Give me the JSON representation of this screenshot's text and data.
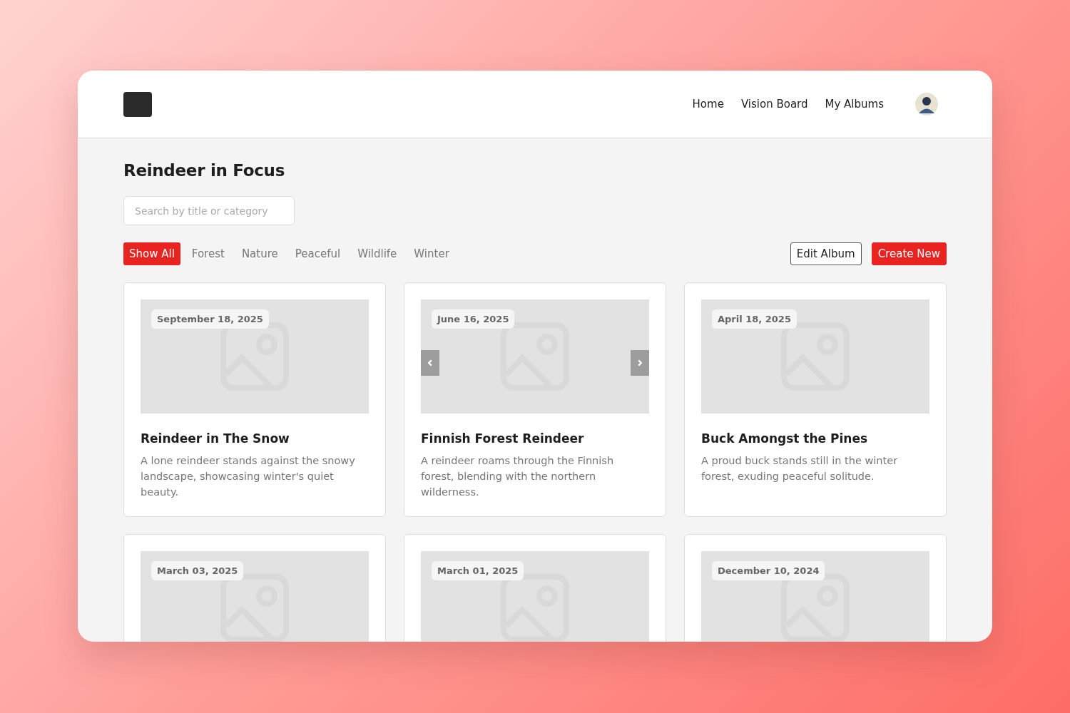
{
  "nav": {
    "links": [
      "Home",
      "Vision Board",
      "My Albums"
    ]
  },
  "page": {
    "title": "Reindeer in Focus",
    "search": {
      "placeholder": "Search by title or category"
    }
  },
  "filters": [
    {
      "label": "Show All",
      "selected": true
    },
    {
      "label": "Forest",
      "selected": false
    },
    {
      "label": "Nature",
      "selected": false
    },
    {
      "label": "Peaceful",
      "selected": false
    },
    {
      "label": "Wildlife",
      "selected": false
    },
    {
      "label": "Winter",
      "selected": false
    }
  ],
  "actions": [
    {
      "label": "Edit Album",
      "kind": "outline"
    },
    {
      "label": "Create New",
      "kind": "primary"
    }
  ],
  "cards": [
    {
      "date": "September 18, 2025",
      "title": "Reindeer in The Snow",
      "description": "A lone reindeer stands against the snowy landscape, showcasing winter's quiet beauty.",
      "arrows": false
    },
    {
      "date": "June 16, 2025",
      "title": "Finnish Forest Reindeer",
      "description": "A reindeer roams through the Finnish forest, blending with the northern wilderness.",
      "arrows": true
    },
    {
      "date": "April 18, 2025",
      "title": "Buck Amongst the Pines",
      "description": "A proud buck stands still in the winter forest, exuding peaceful solitude.",
      "arrows": false
    },
    {
      "date": "March 03, 2025",
      "arrows": false
    },
    {
      "date": "March 01, 2025",
      "arrows": false
    },
    {
      "date": "December 10, 2024",
      "arrows": false
    }
  ]
}
